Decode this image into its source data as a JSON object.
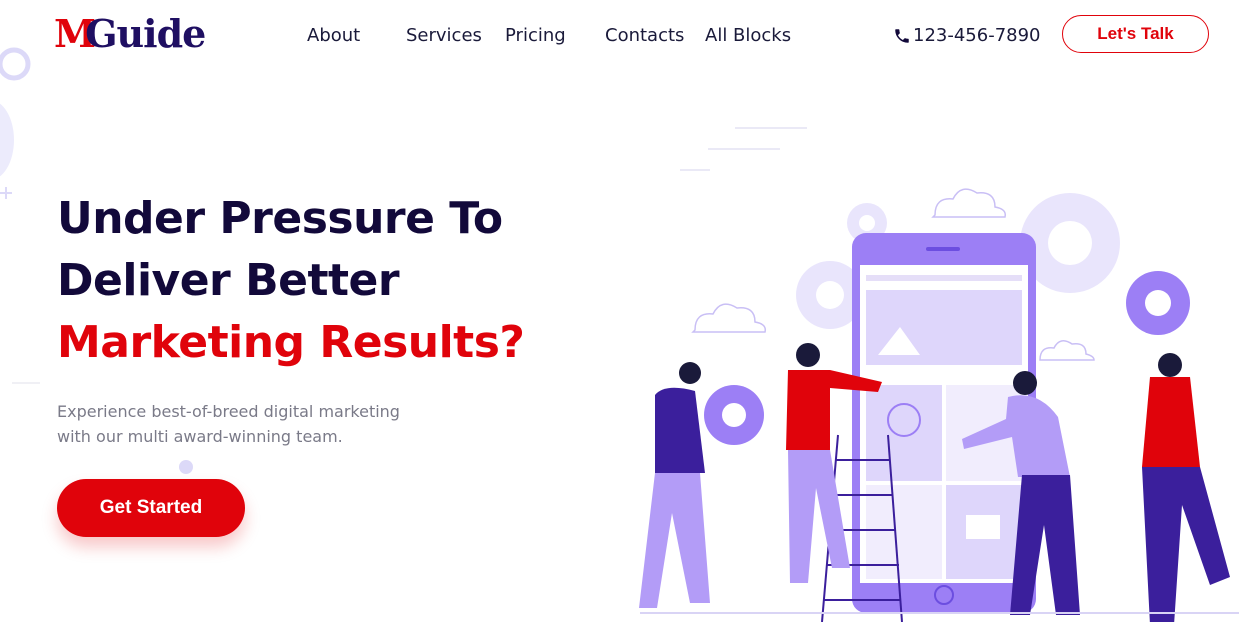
{
  "brand": {
    "logo_m": "M",
    "logo_rest": "Guide"
  },
  "nav": {
    "items": [
      {
        "label": "About"
      },
      {
        "label": "Services"
      },
      {
        "label": "Pricing"
      },
      {
        "label": "Contacts"
      },
      {
        "label": "All Blocks"
      }
    ],
    "phone": "123-456-7890",
    "cta_label": "Let's Talk"
  },
  "hero": {
    "title_line1": "Under Pressure To",
    "title_line2": "Deliver Better",
    "title_line3": "Marketing Results?",
    "subtitle_line1": "Experience best-of-breed digital marketing",
    "subtitle_line2": "with our multi award-winning team.",
    "button_label": "Get Started"
  },
  "colors": {
    "brand_navy": "#1f0f62",
    "accent_red": "#e0030b",
    "illustration_purple": "#9c7ff5",
    "text_gray": "#7a7a88"
  },
  "icons": [
    "phone-icon",
    "marketing-team-illustration"
  ]
}
